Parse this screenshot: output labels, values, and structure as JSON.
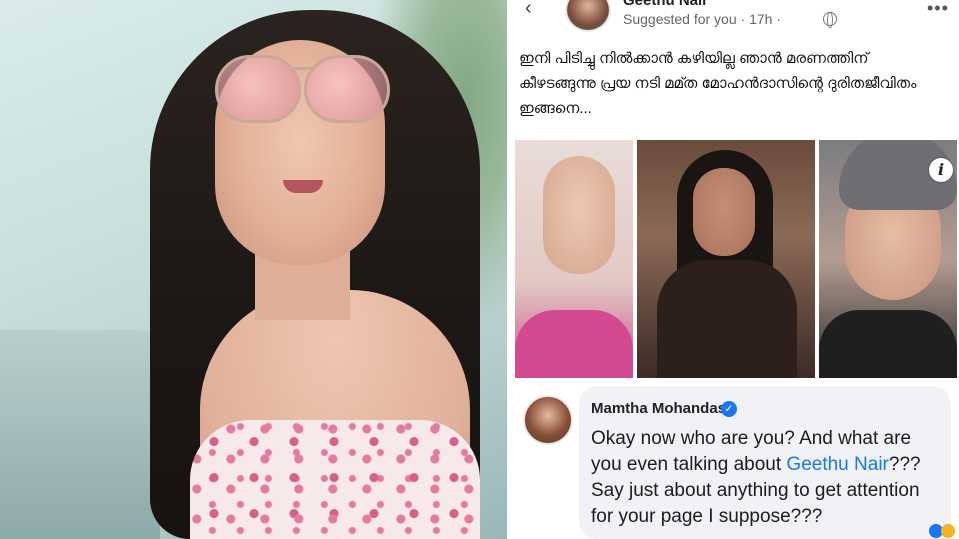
{
  "post": {
    "author_name": "Geethu Nair",
    "meta": "Suggested for you · 17h ·",
    "text": "ഇനി പിടിച്ചു നിൽക്കാൻ കഴിയില്ല ഞാൻ മരണത്തിന് കീഴടങ്ങുന്നു പ്രയ നടി മമ്ത മോഹൻദാസിന്റെ ദുരിതജീവിതം ഇങ്ങനെ...",
    "info_label": "i"
  },
  "comment": {
    "author_name": "Mamtha Mohandas",
    "text_before_link": "Okay now who are you? And what are you even talking about ",
    "link_text": "Geethu Nair",
    "text_after_link": "??? Say just about anything to get attention for your page I suppose???"
  },
  "icons": {
    "back": "back-arrow-icon",
    "globe": "globe-icon",
    "more": "more-options-icon",
    "verified": "verified-badge-icon"
  },
  "colors": {
    "link": "#1877f2",
    "bubble": "#f0f2f5"
  }
}
